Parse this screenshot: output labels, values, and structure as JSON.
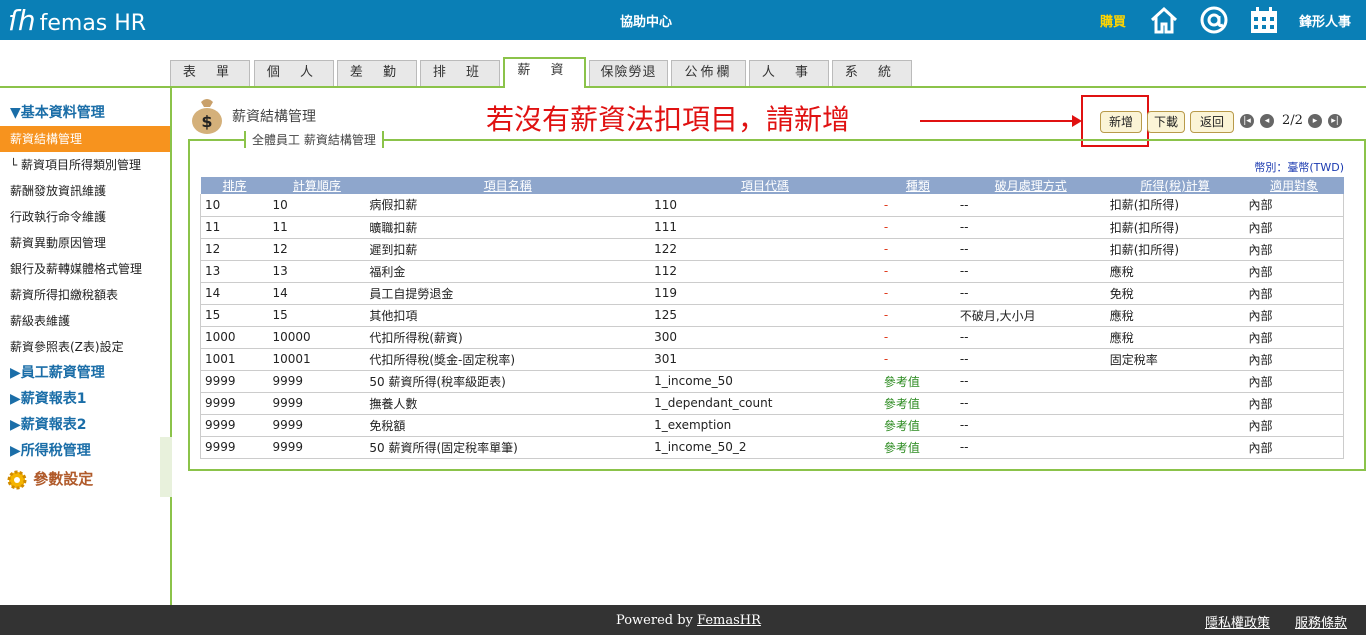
{
  "header": {
    "logo": "femas HR",
    "center_title": "協助中心",
    "buy": "購買",
    "user": "鋒形人事",
    "icons": [
      "home-icon",
      "at-icon",
      "calendar-icon"
    ]
  },
  "tabs": [
    "表 單",
    "個 人",
    "差 勤",
    "排 班",
    "薪 資",
    "保險勞退",
    "公佈欄",
    "人 事",
    "系 統"
  ],
  "sidebar": {
    "section1": "▼基本資料管理",
    "items": [
      "薪資結構管理",
      "└ 薪資項目所得類別管理",
      "薪酬發放資訊維護",
      "行政執行命令維護",
      "薪資異動原因管理",
      "銀行及薪轉媒體格式管理",
      "薪資所得扣繳稅額表",
      "薪級表維護",
      "薪資參照表(Z表)設定"
    ],
    "sections": [
      "▶員工薪資管理",
      "▶薪資報表1",
      "▶薪資報表2",
      "▶所得稅管理"
    ],
    "gear_label": "參數設定"
  },
  "main": {
    "title": "薪資結構管理",
    "hint": "若沒有薪資法扣項目，請新增",
    "buttons": {
      "add": "新增",
      "download": "下載",
      "back": "返回"
    },
    "pager": "2/2",
    "legend": "全體員工 薪資結構管理",
    "currency": "幣別：臺幣(TWD)",
    "columns": [
      "排序",
      "計算順序",
      "項目名稱",
      "項目代碼",
      "種類",
      "破月處理方式",
      "所得(稅)計算",
      "適用對象"
    ],
    "rows": [
      [
        "10",
        "10",
        "病假扣薪",
        "110",
        "-",
        "--",
        "扣薪(扣所得)",
        "內部"
      ],
      [
        "11",
        "11",
        "曠職扣薪",
        "111",
        "-",
        "--",
        "扣薪(扣所得)",
        "內部"
      ],
      [
        "12",
        "12",
        "遲到扣薪",
        "122",
        "-",
        "--",
        "扣薪(扣所得)",
        "內部"
      ],
      [
        "13",
        "13",
        "福利金",
        "112",
        "-",
        "--",
        "應稅",
        "內部"
      ],
      [
        "14",
        "14",
        "員工自提勞退金",
        "119",
        "-",
        "--",
        "免稅",
        "內部"
      ],
      [
        "15",
        "15",
        "其他扣項",
        "125",
        "-",
        "不破月,大小月",
        "應稅",
        "內部"
      ],
      [
        "1000",
        "10000",
        "代扣所得稅(薪資)",
        "300",
        "-",
        "--",
        "應稅",
        "內部"
      ],
      [
        "1001",
        "10001",
        "代扣所得稅(獎金-固定稅率)",
        "301",
        "-",
        "--",
        "固定稅率",
        "內部"
      ],
      [
        "9999",
        "9999",
        "50 薪資所得(稅率級距表)",
        "1_income_50",
        "參考值",
        "--",
        "",
        "內部"
      ],
      [
        "9999",
        "9999",
        "撫養人數",
        "1_dependant_count",
        "參考值",
        "--",
        "",
        "內部"
      ],
      [
        "9999",
        "9999",
        "免稅額",
        "1_exemption",
        "參考值",
        "--",
        "",
        "內部"
      ],
      [
        "9999",
        "9999",
        "50 薪資所得(固定稅率單筆)",
        "1_income_50_2",
        "參考值",
        "--",
        "",
        "內部"
      ]
    ]
  },
  "footer": {
    "powered_prefix": "Powered by ",
    "powered_link": "FemasHR",
    "privacy": "隱私權政策",
    "terms": "服務條款"
  }
}
